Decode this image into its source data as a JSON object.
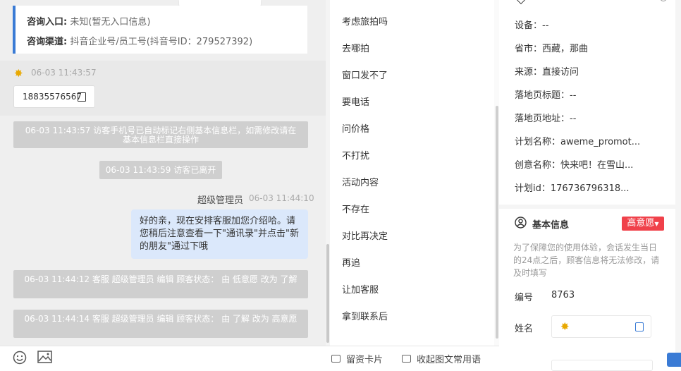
{
  "chat": {
    "entry_label": "咨询入口:",
    "entry_value": "未知(暂无入口信息)",
    "channel_label": "咨询渠道:",
    "channel_value": "抖音企业号/员工号(抖音号ID：279527392)",
    "visitor_time": "06-03 11:43:57",
    "phone": "18835576567",
    "sys_msg_1": "06-03 11:43:57 访客手机号已自动标记右侧基本信息栏，如需修改请在基本信息栏直接操作",
    "sys_msg_2": "06-03 11:43:59 访客已离开",
    "agent_name": "超级管理员",
    "agent_time": "06-03 11:44:10",
    "agent_msg": "好的亲，现在安排客服加您介绍哈。请您稍后注意查看一下\"通讯录\"并点击\"新的朋友\"通过下哦",
    "sys_msg_3": "06-03 11:44:12 客服 超级管理员 编辑 顾客状态： 由 低意愿 改为 了解",
    "sys_msg_4": "06-03 11:44:14 客服 超级管理员 编辑 顾客状态： 由 了解 改为 高意愿"
  },
  "inputbar": {
    "leave_card": "留资卡片",
    "collapse_phrases": "收起图文常用语"
  },
  "quick_replies": [
    "考虑旅拍吗",
    "去哪拍",
    "窗口发不了",
    "要电话",
    "问价格",
    "不打扰",
    "活动内容",
    "不存在",
    "对比再决定",
    "再追",
    "让加客服",
    "拿到联系后"
  ],
  "visitor_info": {
    "device": "设备：--",
    "province_city": "省市：西藏，那曲",
    "source": "来源：直接访问",
    "landing_title": "落地页标题：--",
    "landing_url": "落地页地址：--",
    "plan_name": "计划名称：aweme_promot...",
    "creative_name": "创意名称：快来吧！在雪山...",
    "plan_id": "计划id：176736796318..."
  },
  "basic_info": {
    "title": "基本信息",
    "intent_tag": "高意愿",
    "notice": "为了保障您的使用体验，会话发生当日的24点之后，顾客信息将无法修改，请及时填写",
    "id_label": "编号",
    "id_value": "8763",
    "name_label": "姓名"
  },
  "colors": {
    "accent": "#3a7bd5",
    "intent_red": "#f0414a",
    "bubble": "#dbe8fb",
    "system_msg": "#cfcfcf"
  }
}
